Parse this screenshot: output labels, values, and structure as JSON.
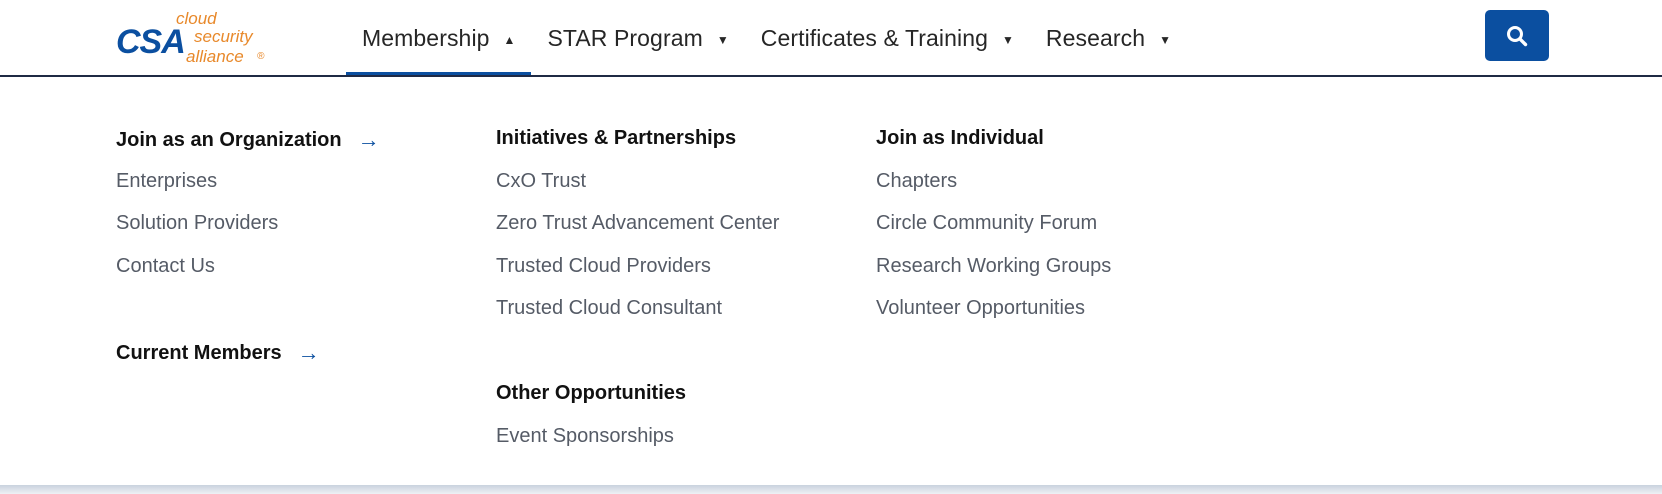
{
  "logo": {
    "mark": "CSA",
    "line1": "cloud",
    "line2": "security",
    "line3": "alliance",
    "registered": "®",
    "mark_color": "#0b4fa0",
    "text_color": "#e8892b"
  },
  "nav": {
    "items": [
      {
        "label": "Membership",
        "caret": "▲",
        "active": true
      },
      {
        "label": "STAR Program",
        "caret": "▼"
      },
      {
        "label": "Certificates & Training",
        "caret": "▼"
      },
      {
        "label": "Research",
        "caret": "▼"
      }
    ],
    "accent_color": "#0b4fa0"
  },
  "search": {
    "icon": "search-icon",
    "color": "#0b4fa0"
  },
  "dropdown": {
    "columns": [
      {
        "sections": [
          {
            "heading": "Join as an Organization",
            "arrow": "→",
            "links": [
              "Enterprises",
              "Solution Providers",
              "Contact Us"
            ]
          },
          {
            "heading": "Current Members",
            "arrow": "→",
            "links": []
          }
        ]
      },
      {
        "sections": [
          {
            "heading": "Initiatives & Partnerships",
            "links": [
              "CxO Trust",
              "Zero Trust Advancement Center",
              "Trusted Cloud Providers",
              "Trusted Cloud Consultant"
            ]
          },
          {
            "heading": "Other Opportunities",
            "links": [
              "Event Sponsorships"
            ]
          }
        ]
      },
      {
        "sections": [
          {
            "heading": "Join as Individual",
            "links": [
              "Chapters",
              "Circle Community Forum",
              "Research Working Groups",
              "Volunteer Opportunities"
            ]
          }
        ]
      }
    ]
  }
}
